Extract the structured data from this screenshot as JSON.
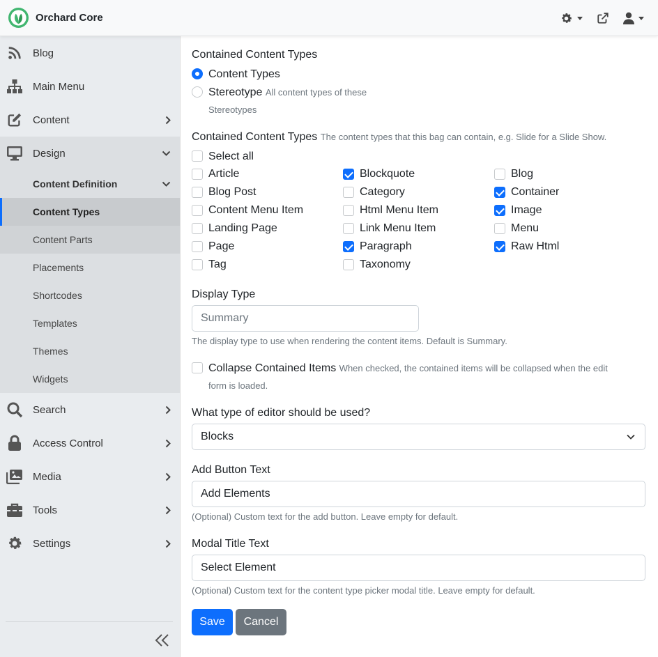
{
  "app": {
    "title": "Orchard Core"
  },
  "header": {
    "icons": [
      "settings-gear-icon",
      "external-link-icon",
      "user-icon"
    ]
  },
  "sidebar": {
    "items": [
      {
        "label": "Blog",
        "icon": "rss-icon"
      },
      {
        "label": "Main Menu",
        "icon": "sitemap-icon"
      },
      {
        "label": "Content",
        "icon": "edit-icon"
      },
      {
        "label": "Design",
        "icon": "desktop-icon"
      },
      {
        "label": "Search",
        "icon": "search-icon"
      },
      {
        "label": "Access Control",
        "icon": "lock-icon"
      },
      {
        "label": "Media",
        "icon": "images-icon"
      },
      {
        "label": "Tools",
        "icon": "toolbox-icon"
      },
      {
        "label": "Settings",
        "icon": "gear-icon"
      }
    ],
    "design_sub": {
      "content_definition": "Content Definition",
      "items": [
        "Content Types",
        "Content Parts",
        "Placements",
        "Shortcodes",
        "Templates",
        "Themes",
        "Widgets"
      ]
    }
  },
  "form": {
    "contained_section_title": "Contained Content Types",
    "radio_content_types": "Content Types",
    "radio_stereotype": "Stereotype",
    "radio_stereotype_hint": "All content types of these",
    "radio_stereotype_hint2": "Stereotypes",
    "selected_radio": "Content Types",
    "types_title": "Contained Content Types",
    "types_hint": "The content types that this bag can contain, e.g. Slide for a Slide Show.",
    "select_all": "Select all",
    "types": [
      {
        "label": "Article",
        "checked": false
      },
      {
        "label": "Blockquote",
        "checked": true
      },
      {
        "label": "Blog",
        "checked": false
      },
      {
        "label": "Blog Post",
        "checked": false
      },
      {
        "label": "Category",
        "checked": false
      },
      {
        "label": "Container",
        "checked": true
      },
      {
        "label": "Content Menu Item",
        "checked": false
      },
      {
        "label": "Html Menu Item",
        "checked": false
      },
      {
        "label": "Image",
        "checked": true
      },
      {
        "label": "Landing Page",
        "checked": false
      },
      {
        "label": "Link Menu Item",
        "checked": false
      },
      {
        "label": "Menu",
        "checked": false
      },
      {
        "label": "Page",
        "checked": false
      },
      {
        "label": "Paragraph",
        "checked": true
      },
      {
        "label": "Raw Html",
        "checked": true
      },
      {
        "label": "Tag",
        "checked": false
      },
      {
        "label": "Taxonomy",
        "checked": false
      }
    ],
    "display_type_label": "Display Type",
    "display_type_placeholder": "Summary",
    "display_type_hint": "The display type to use when rendering the content items. Default is Summary.",
    "collapse_label": "Collapse Contained Items",
    "collapse_hint": "When checked, the contained items will be collapsed when the edit",
    "collapse_hint2": "form is loaded.",
    "collapse_checked": false,
    "editor_label": "What type of editor should be used?",
    "editor_value": "Blocks",
    "add_button_label": "Add Button Text",
    "add_button_value": "Add Elements",
    "add_button_hint": "(Optional) Custom text for the add button. Leave empty for default.",
    "modal_title_label": "Modal Title Text",
    "modal_title_value": "Select Element",
    "modal_title_hint": "(Optional) Custom text for the content type picker modal title. Leave empty for default.",
    "save": "Save",
    "cancel": "Cancel"
  },
  "colors": {
    "accent": "#0d6efd",
    "secondary": "#6c757d",
    "brand_green": "#41b670"
  }
}
